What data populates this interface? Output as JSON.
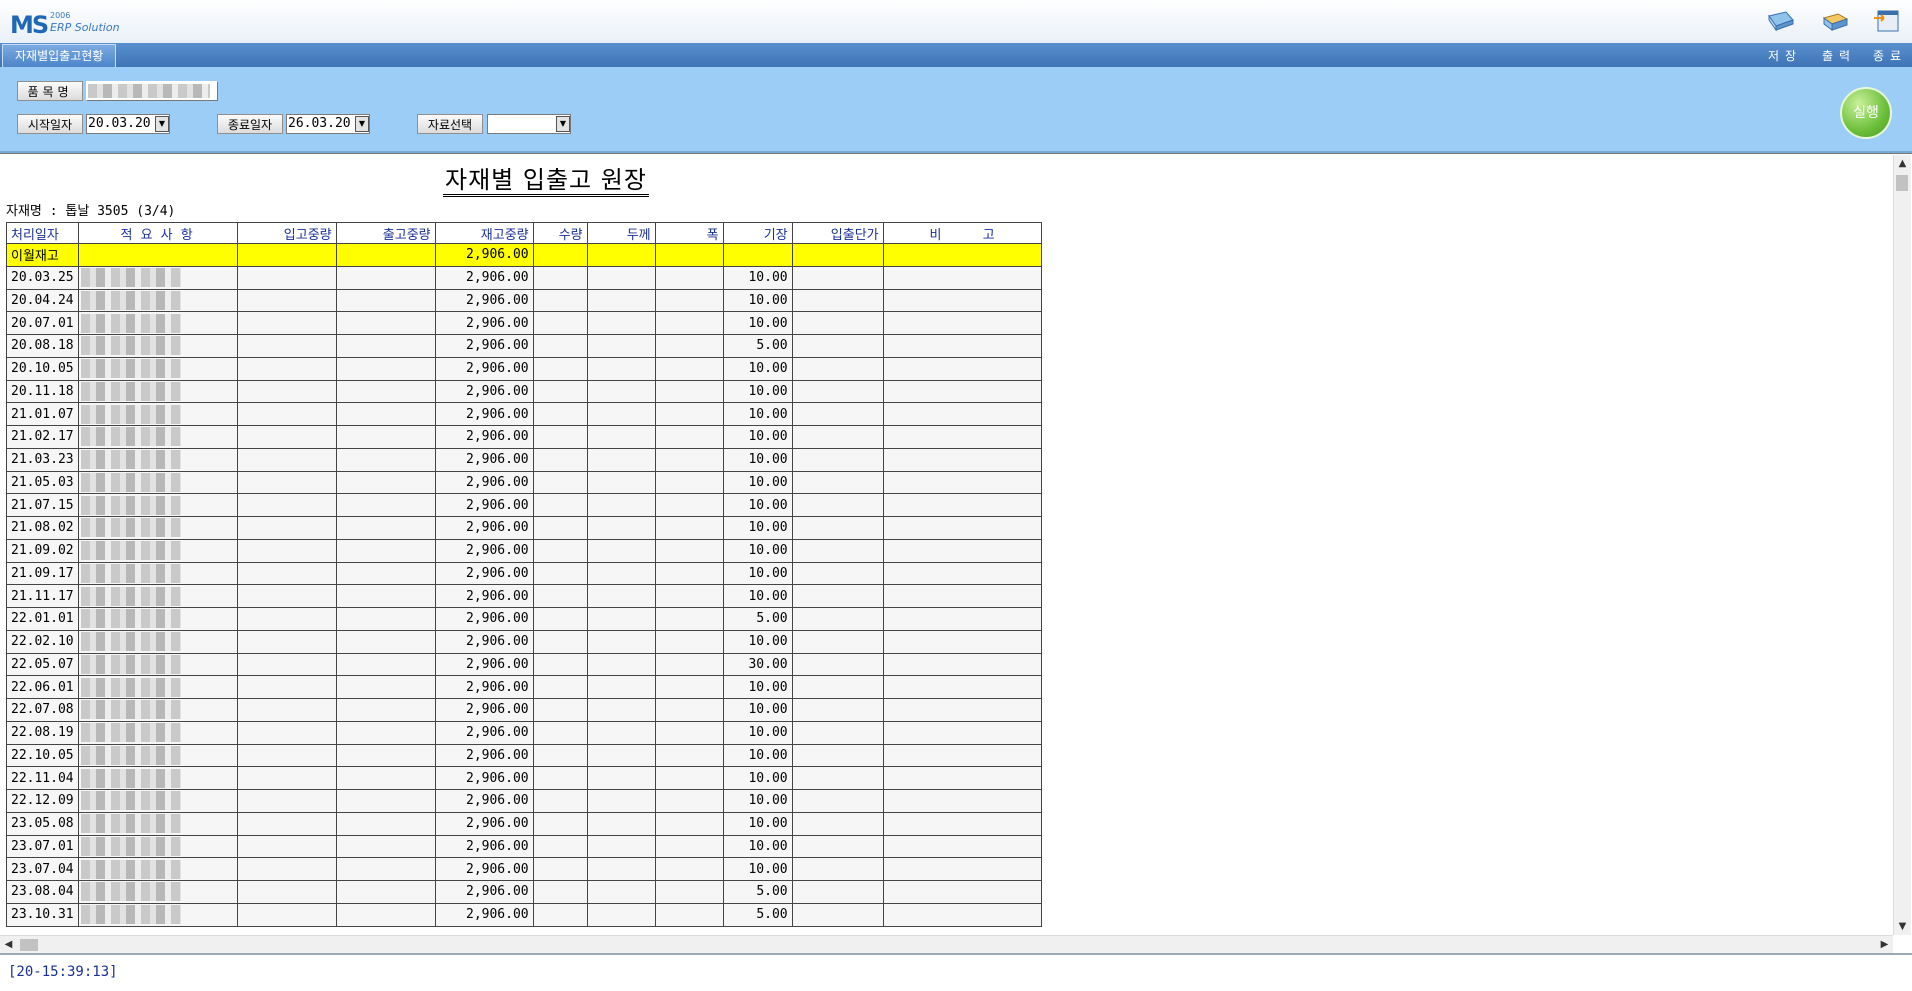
{
  "app": {
    "logo_text": "MS",
    "logo_year": "2006",
    "logo_subtitle": "ERP Solution"
  },
  "toolbar": {
    "save_label": "저장",
    "print_label": "출력",
    "exit_label": "종료"
  },
  "tab": {
    "label": "자재별입출고현황"
  },
  "filters": {
    "item_name_label": "품목명",
    "start_date_label": "시작일자",
    "start_date_value": "20.03.20",
    "end_date_label": "종료일자",
    "end_date_value": "26.03.20",
    "data_select_label": "자료선택",
    "data_select_value": "",
    "run_label": "실행"
  },
  "report": {
    "title": "자재별 입출고 원장",
    "material_line": "자재명 : 톱날 3505 (3/4)",
    "columns": [
      "처리일자",
      "적 요 사 항",
      "입고중량",
      "출고중량",
      "재고중량",
      "수량",
      "두께",
      "폭",
      "기장",
      "입출단가",
      "비          고"
    ],
    "opening_row": {
      "date": "이월재고",
      "stock": "2,906.00"
    },
    "rows": [
      {
        "date": "20.03.25",
        "stock": "2,906.00",
        "length": "10.00"
      },
      {
        "date": "20.04.24",
        "stock": "2,906.00",
        "length": "10.00"
      },
      {
        "date": "20.07.01",
        "stock": "2,906.00",
        "length": "10.00"
      },
      {
        "date": "20.08.18",
        "stock": "2,906.00",
        "length": "5.00"
      },
      {
        "date": "20.10.05",
        "stock": "2,906.00",
        "length": "10.00"
      },
      {
        "date": "20.11.18",
        "stock": "2,906.00",
        "length": "10.00"
      },
      {
        "date": "21.01.07",
        "stock": "2,906.00",
        "length": "10.00"
      },
      {
        "date": "21.02.17",
        "stock": "2,906.00",
        "length": "10.00"
      },
      {
        "date": "21.03.23",
        "stock": "2,906.00",
        "length": "10.00"
      },
      {
        "date": "21.05.03",
        "stock": "2,906.00",
        "length": "10.00"
      },
      {
        "date": "21.07.15",
        "stock": "2,906.00",
        "length": "10.00"
      },
      {
        "date": "21.08.02",
        "stock": "2,906.00",
        "length": "10.00"
      },
      {
        "date": "21.09.02",
        "stock": "2,906.00",
        "length": "10.00"
      },
      {
        "date": "21.09.17",
        "stock": "2,906.00",
        "length": "10.00"
      },
      {
        "date": "21.11.17",
        "stock": "2,906.00",
        "length": "10.00"
      },
      {
        "date": "22.01.01",
        "stock": "2,906.00",
        "length": "5.00"
      },
      {
        "date": "22.02.10",
        "stock": "2,906.00",
        "length": "10.00"
      },
      {
        "date": "22.05.07",
        "stock": "2,906.00",
        "length": "30.00"
      },
      {
        "date": "22.06.01",
        "stock": "2,906.00",
        "length": "10.00"
      },
      {
        "date": "22.07.08",
        "stock": "2,906.00",
        "length": "10.00"
      },
      {
        "date": "22.08.19",
        "stock": "2,906.00",
        "length": "10.00"
      },
      {
        "date": "22.10.05",
        "stock": "2,906.00",
        "length": "10.00"
      },
      {
        "date": "22.11.04",
        "stock": "2,906.00",
        "length": "10.00"
      },
      {
        "date": "22.12.09",
        "stock": "2,906.00",
        "length": "10.00"
      },
      {
        "date": "23.05.08",
        "stock": "2,906.00",
        "length": "10.00"
      },
      {
        "date": "23.07.01",
        "stock": "2,906.00",
        "length": "10.00"
      },
      {
        "date": "23.07.04",
        "stock": "2,906.00",
        "length": "10.00"
      },
      {
        "date": "23.08.04",
        "stock": "2,906.00",
        "length": "5.00"
      },
      {
        "date": "23.10.31",
        "stock": "2,906.00",
        "length": "5.00"
      }
    ]
  },
  "status": {
    "text": "[20-15:39:13]"
  },
  "colors": {
    "accent": "#3e73b6",
    "filter_bg": "#9ccdf7",
    "highlight_row": "#ffff00",
    "header_text": "#1a2f9a"
  }
}
